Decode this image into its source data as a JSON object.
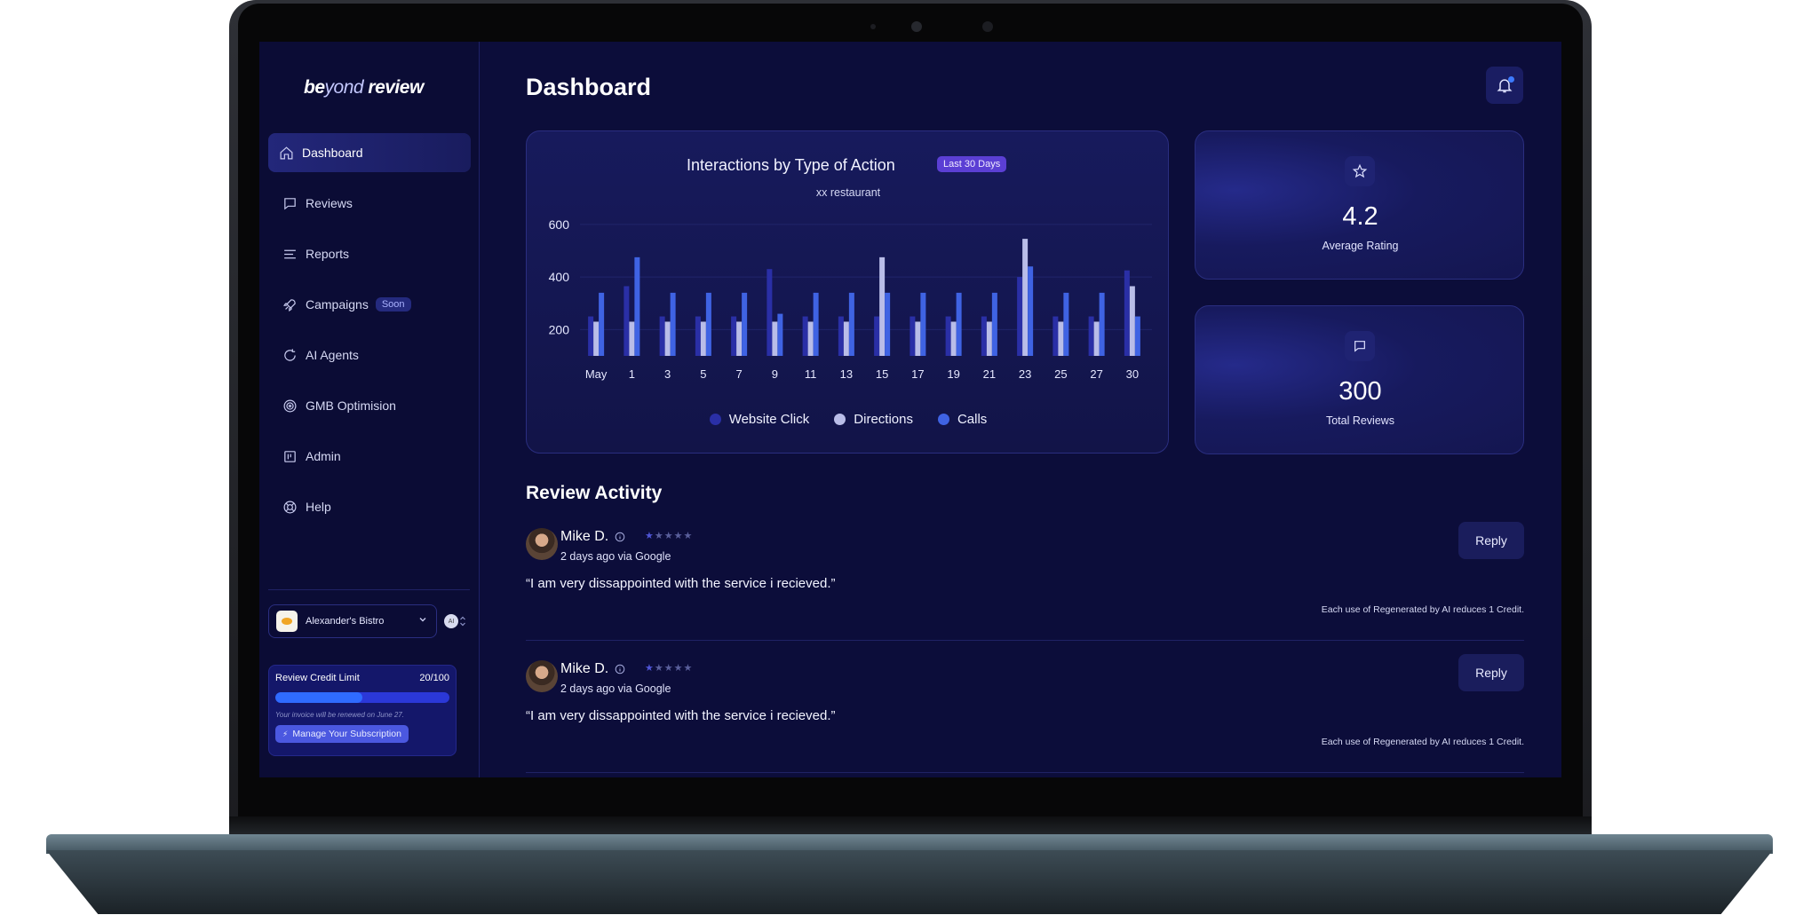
{
  "brand": {
    "part1": "be",
    "part2": "yond",
    "part3": " review"
  },
  "nav": [
    {
      "label": "Dashboard",
      "icon": "home-icon",
      "active": true
    },
    {
      "label": "Reviews",
      "icon": "message-icon"
    },
    {
      "label": "Reports",
      "icon": "list-icon"
    },
    {
      "label": "Campaigns",
      "icon": "rocket-icon",
      "badge": "Soon"
    },
    {
      "label": "AI Agents",
      "icon": "refresh-icon"
    },
    {
      "label": "GMB Optimision",
      "icon": "target-icon"
    },
    {
      "label": "Admin",
      "icon": "layout-icon"
    },
    {
      "label": "Help",
      "icon": "lifebuoy-icon"
    }
  ],
  "business": {
    "name": "Alexander's Bistro",
    "toggle_label": "AI"
  },
  "credit": {
    "title": "Review Credit Limit",
    "count": "20/100",
    "fraction": 0.5,
    "note": "Your invoice will be renewed on June 27.",
    "button": "Manage Your Subscription"
  },
  "header": {
    "title": "Dashboard"
  },
  "chart_card": {
    "title": "Interactions by Type of Action",
    "badge": "Last 30 Days",
    "subtitle": "xx restaurant"
  },
  "chart_data": {
    "type": "bar",
    "title": "Interactions by Type of Action",
    "subtitle": "xx restaurant",
    "xlabel": "",
    "ylabel": "",
    "y_ticks": [
      200,
      400,
      600
    ],
    "ylim": [
      100,
      650
    ],
    "x_tick_labels": [
      "May",
      "1",
      "3",
      "5",
      "7",
      "9",
      "11",
      "13",
      "15",
      "17",
      "19",
      "21",
      "23",
      "25",
      "27",
      "30"
    ],
    "categories": [
      "May",
      "1",
      "3",
      "5",
      "7",
      "9",
      "11",
      "13",
      "15",
      "17",
      "19",
      "21",
      "23",
      "25",
      "27",
      "30"
    ],
    "series": [
      {
        "name": "Website Click",
        "color": "#2a2fa6",
        "values": [
          250,
          365,
          250,
          250,
          250,
          430,
          250,
          250,
          250,
          250,
          250,
          250,
          400,
          250,
          250,
          425
        ]
      },
      {
        "name": "Directions",
        "color": "#b9bde8",
        "values": [
          230,
          230,
          230,
          230,
          230,
          230,
          230,
          230,
          475,
          230,
          230,
          230,
          545,
          230,
          230,
          365
        ]
      },
      {
        "name": "Calls",
        "color": "#3f63e3",
        "values": [
          340,
          475,
          340,
          340,
          340,
          260,
          340,
          340,
          340,
          340,
          340,
          340,
          440,
          340,
          340,
          250
        ]
      }
    ],
    "grid": true,
    "legend": "bottom"
  },
  "stats": [
    {
      "value": "4.2",
      "label": "Average Rating",
      "icon": "star-icon"
    },
    {
      "value": "300",
      "label": "Total Reviews",
      "icon": "message-icon"
    }
  ],
  "review_section": {
    "title": "Review Activity"
  },
  "reviews": [
    {
      "name": "Mike D.",
      "rating": 1,
      "meta": "2 days ago via Google",
      "quote": "“I am very dissappointed with the service i recieved.”",
      "reply": "Reply",
      "credit_note": "Each use of Regenerated by AI reduces 1 Credit."
    },
    {
      "name": "Mike D.",
      "rating": 1,
      "meta": "2 days ago via Google",
      "quote": "“I am very dissappointed with the service i recieved.”",
      "reply": "Reply",
      "credit_note": "Each use of Regenerated by AI reduces 1 Credit."
    }
  ]
}
